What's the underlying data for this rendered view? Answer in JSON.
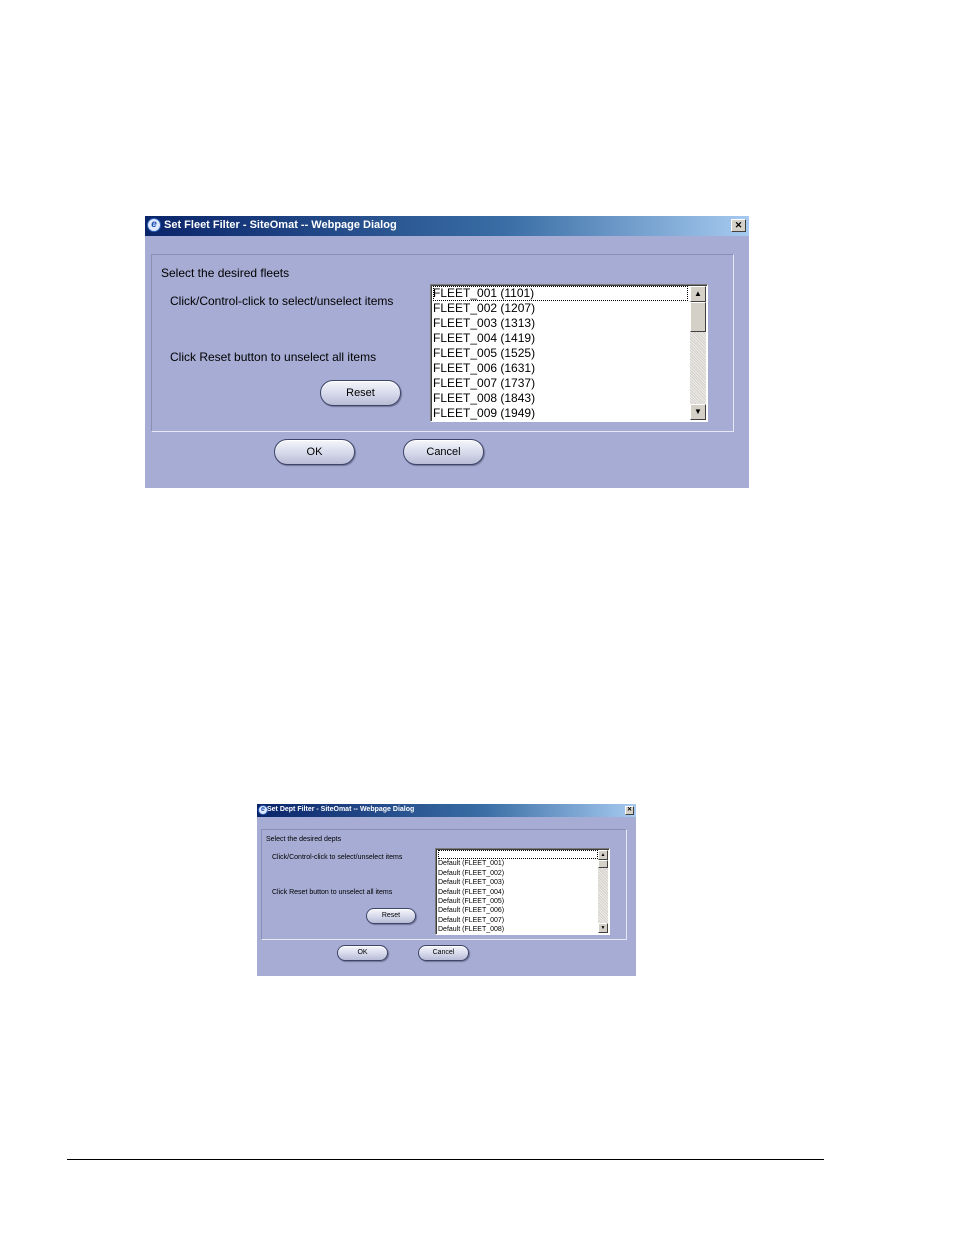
{
  "fleet_dialog": {
    "title": "Set Fleet Filter - SiteOmat -- Webpage Dialog",
    "close_glyph": "✕",
    "heading": "Select the desired fleets",
    "instruction_select": "Click/Control-click to select/unselect items",
    "instruction_reset": "Click Reset button to unselect all items",
    "reset_label": "Reset",
    "ok_label": "OK",
    "cancel_label": "Cancel",
    "items": [
      "FLEET_001 (1101)",
      "FLEET_002 (1207)",
      "FLEET_003 (1313)",
      "FLEET_004 (1419)",
      "FLEET_005 (1525)",
      "FLEET_006 (1631)",
      "FLEET_007 (1737)",
      "FLEET_008 (1843)",
      "FLEET_009 (1949)"
    ]
  },
  "dept_dialog": {
    "title": "Set Dept Filter - SiteOmat -- Webpage Dialog",
    "close_glyph": "✕",
    "heading": "Select the desired depts",
    "instruction_select": "Click/Control-click to select/unselect items",
    "instruction_reset": "Click Reset button to unselect all items",
    "reset_label": "Reset",
    "ok_label": "OK",
    "cancel_label": "Cancel",
    "items": [
      "",
      "Default (FLEET_001)",
      "Default (FLEET_002)",
      "Default (FLEET_003)",
      "Default (FLEET_004)",
      "Default (FLEET_005)",
      "Default (FLEET_006)",
      "Default (FLEET_007)",
      "Default (FLEET_008)"
    ]
  },
  "icons": {
    "window_icon": "ie-icon",
    "scroll_up": "arrow-up-icon",
    "scroll_down": "arrow-down-icon"
  },
  "colors": {
    "dialog_background": "#a6acd3",
    "titlebar_start": "#0a246a",
    "titlebar_end": "#a6caf0"
  }
}
